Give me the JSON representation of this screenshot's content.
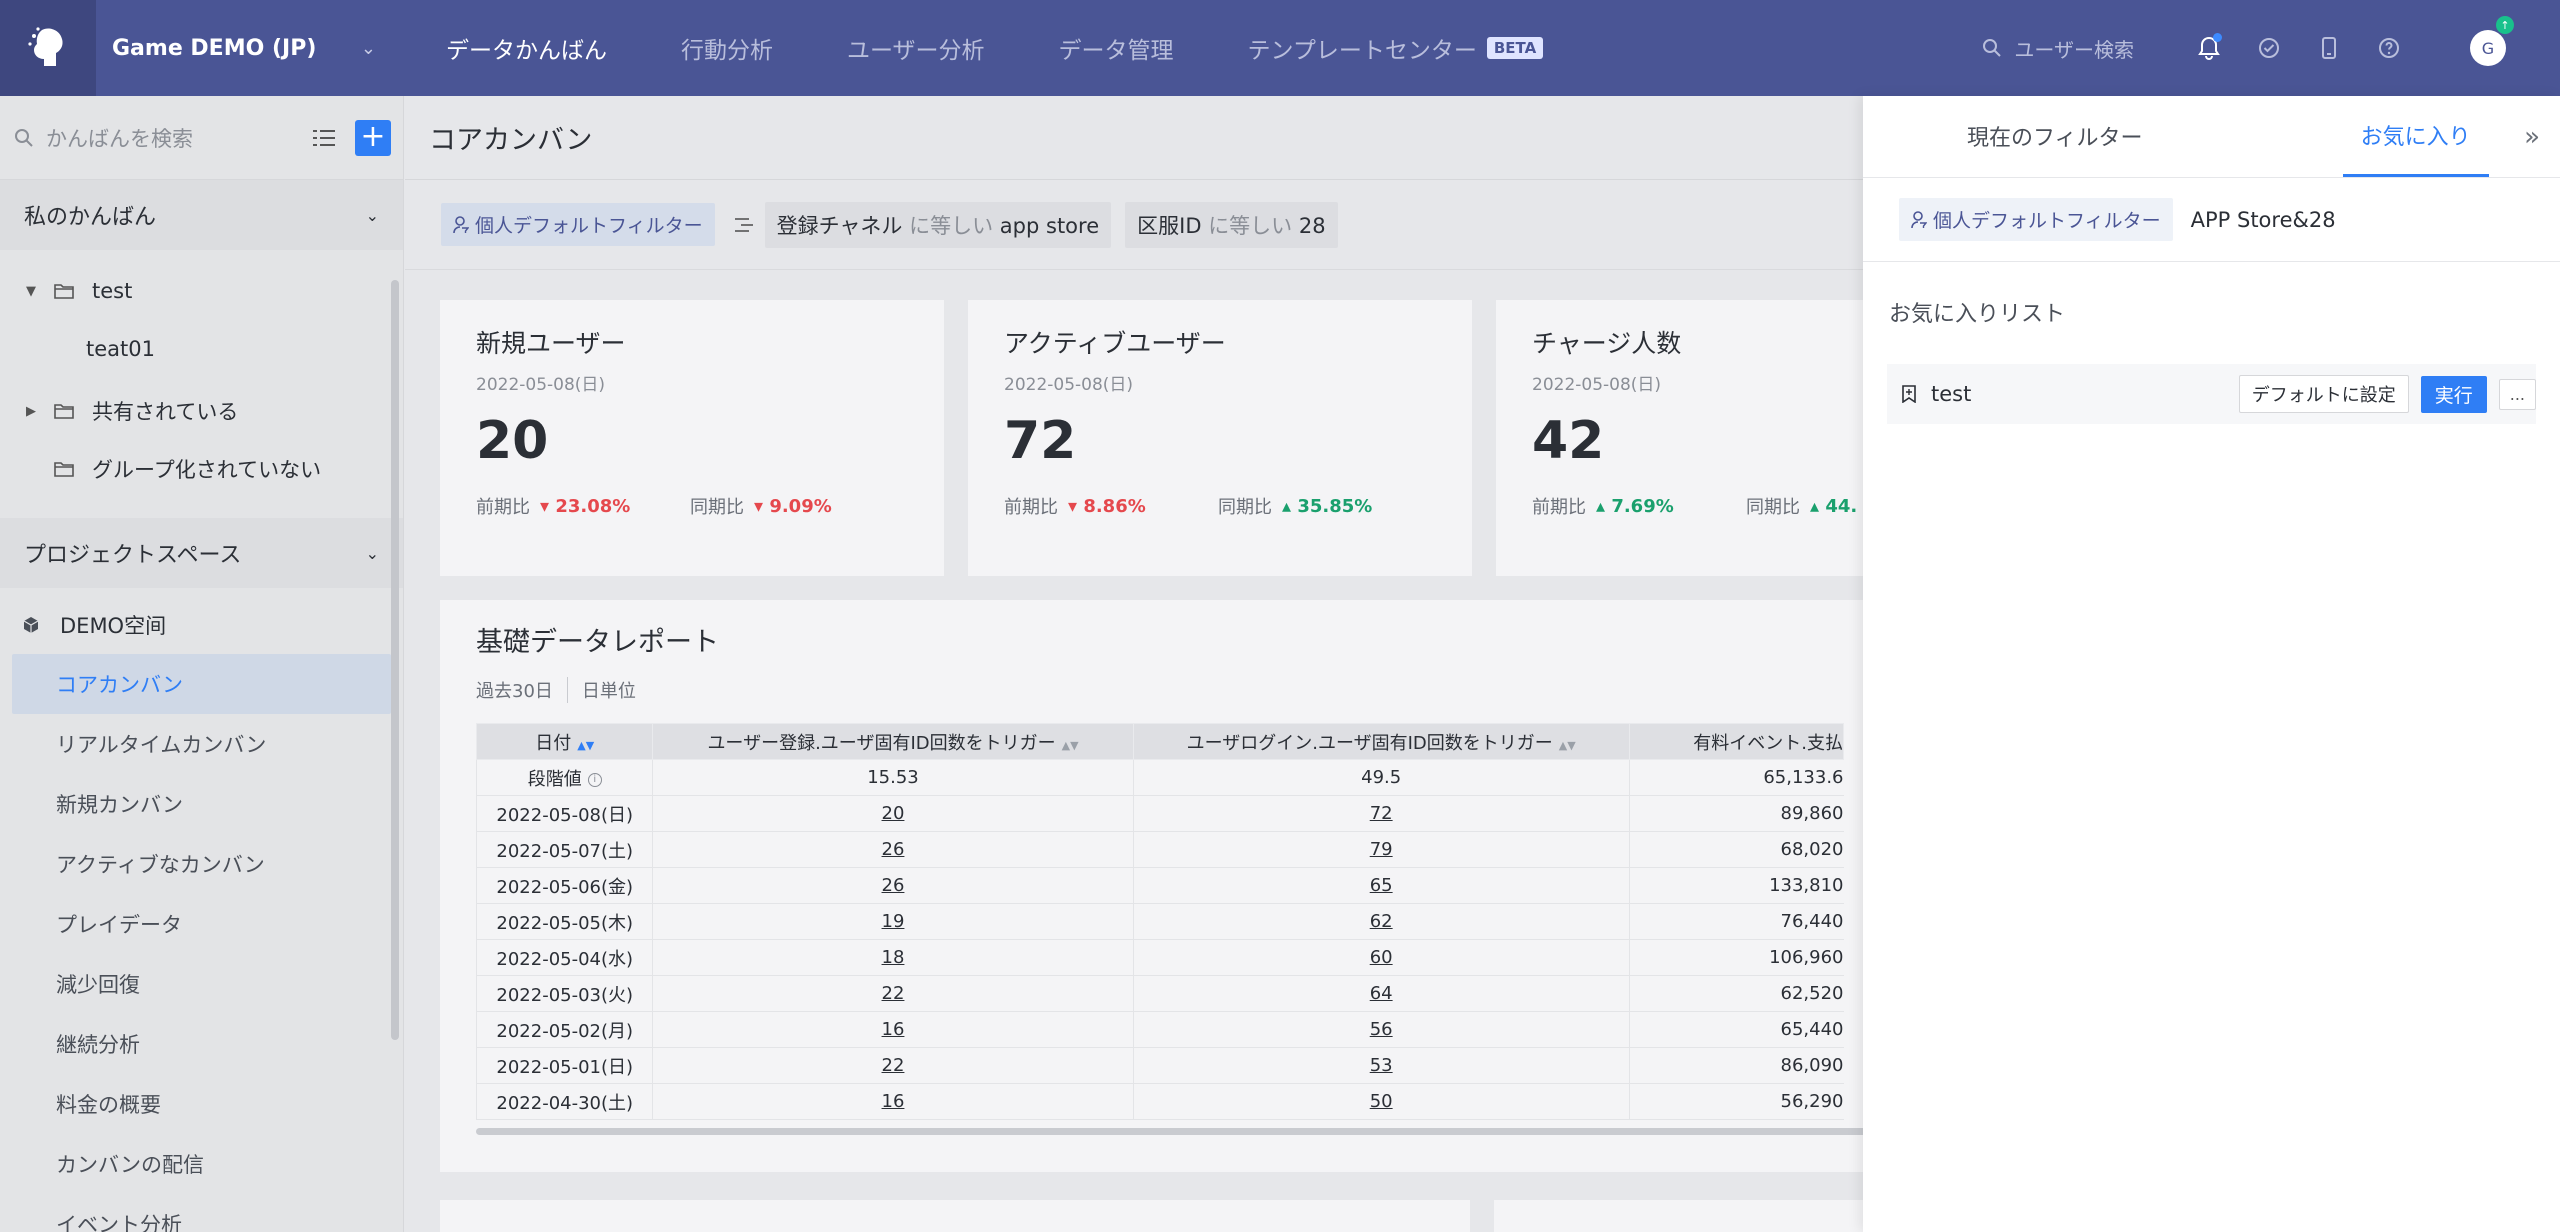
{
  "topbar": {
    "project_name": "Game DEMO (JP)",
    "nav": [
      "データかんばん",
      "行動分析",
      "ユーザー分析",
      "データ管理",
      "テンプレートセンター"
    ],
    "beta": "BETA",
    "search_placeholder": "ユーザー検索",
    "avatar": "G"
  },
  "sidebar": {
    "search_placeholder": "かんばんを検索",
    "my_section": "私のかんばん",
    "tree": {
      "test": "test",
      "teat01": "teat01",
      "shared": "共有されている",
      "ungrouped": "グループ化されていない"
    },
    "project_section": "プロジェクトスペース",
    "space": "DEMO空间",
    "items": [
      "コアカンバン",
      "リアルタイムカンバン",
      "新規カンバン",
      "アクティブなカンバン",
      "プレイデータ",
      "減少回復",
      "継続分析",
      "料金の概要",
      "カンバンの配信",
      "イベント分析"
    ]
  },
  "main": {
    "title": "コアカンバン",
    "default_filter": "個人デフォルトフィルター",
    "filters": [
      {
        "field": "登録チャネル",
        "op": "に等しい",
        "value": "app store"
      },
      {
        "field": "区服ID",
        "op": "に等しい",
        "value": "28"
      }
    ],
    "cards": [
      {
        "title": "新規ユーザー",
        "date": "2022-05-08(日)",
        "value": "20",
        "prev_label": "前期比",
        "prev_val": "23.08%",
        "yoy_label": "同期比",
        "yoy_val": "9.09%"
      },
      {
        "title": "アクティブユーザー",
        "date": "2022-05-08(日)",
        "value": "72",
        "prev_label": "前期比",
        "prev_val": "8.86%",
        "yoy_label": "同期比",
        "yoy_val": "35.85%"
      },
      {
        "title": "チャージ人数",
        "date": "2022-05-08(日)",
        "value": "42",
        "prev_label": "前期比",
        "prev_val": "7.69%",
        "yoy_label": "同期比",
        "yoy_val": "44."
      }
    ],
    "report": {
      "title": "基礎データレポート",
      "range": "過去30日",
      "unit": "日単位",
      "headers": [
        "日付",
        "ユーザー登録.ユーザ固有ID回数をトリガー",
        "ユーザログイン.ユーザ固有ID回数をトリガー",
        "有料イベント.支払"
      ],
      "stage_label": "段階値",
      "stage": [
        "15.53",
        "49.5",
        "65,133.6"
      ],
      "rows": [
        [
          "2022-05-08(日)",
          "20",
          "72",
          "89,860"
        ],
        [
          "2022-05-07(土)",
          "26",
          "79",
          "68,020"
        ],
        [
          "2022-05-06(金)",
          "26",
          "65",
          "133,810"
        ],
        [
          "2022-05-05(木)",
          "19",
          "62",
          "76,440"
        ],
        [
          "2022-05-04(水)",
          "18",
          "60",
          "106,960"
        ],
        [
          "2022-05-03(火)",
          "22",
          "64",
          "62,520"
        ],
        [
          "2022-05-02(月)",
          "16",
          "56",
          "65,440"
        ],
        [
          "2022-05-01(日)",
          "22",
          "53",
          "86,090"
        ],
        [
          "2022-04-30(土)",
          "16",
          "50",
          "56,290"
        ]
      ]
    }
  },
  "drawer": {
    "tab_current": "現在のフィルター",
    "tab_fav": "お気に入り",
    "default_filter": "個人デフォルトフィルター",
    "current_value": "APP Store&28",
    "fav_heading": "お気に入りリスト",
    "fav_item": "test",
    "btn_default": "デフォルトに設定",
    "btn_run": "実行",
    "btn_more": "..."
  },
  "colors": {
    "topbar": "#4a5595",
    "accent": "#2f7ef5",
    "down": "#e5484d",
    "up": "#1aa06d"
  }
}
